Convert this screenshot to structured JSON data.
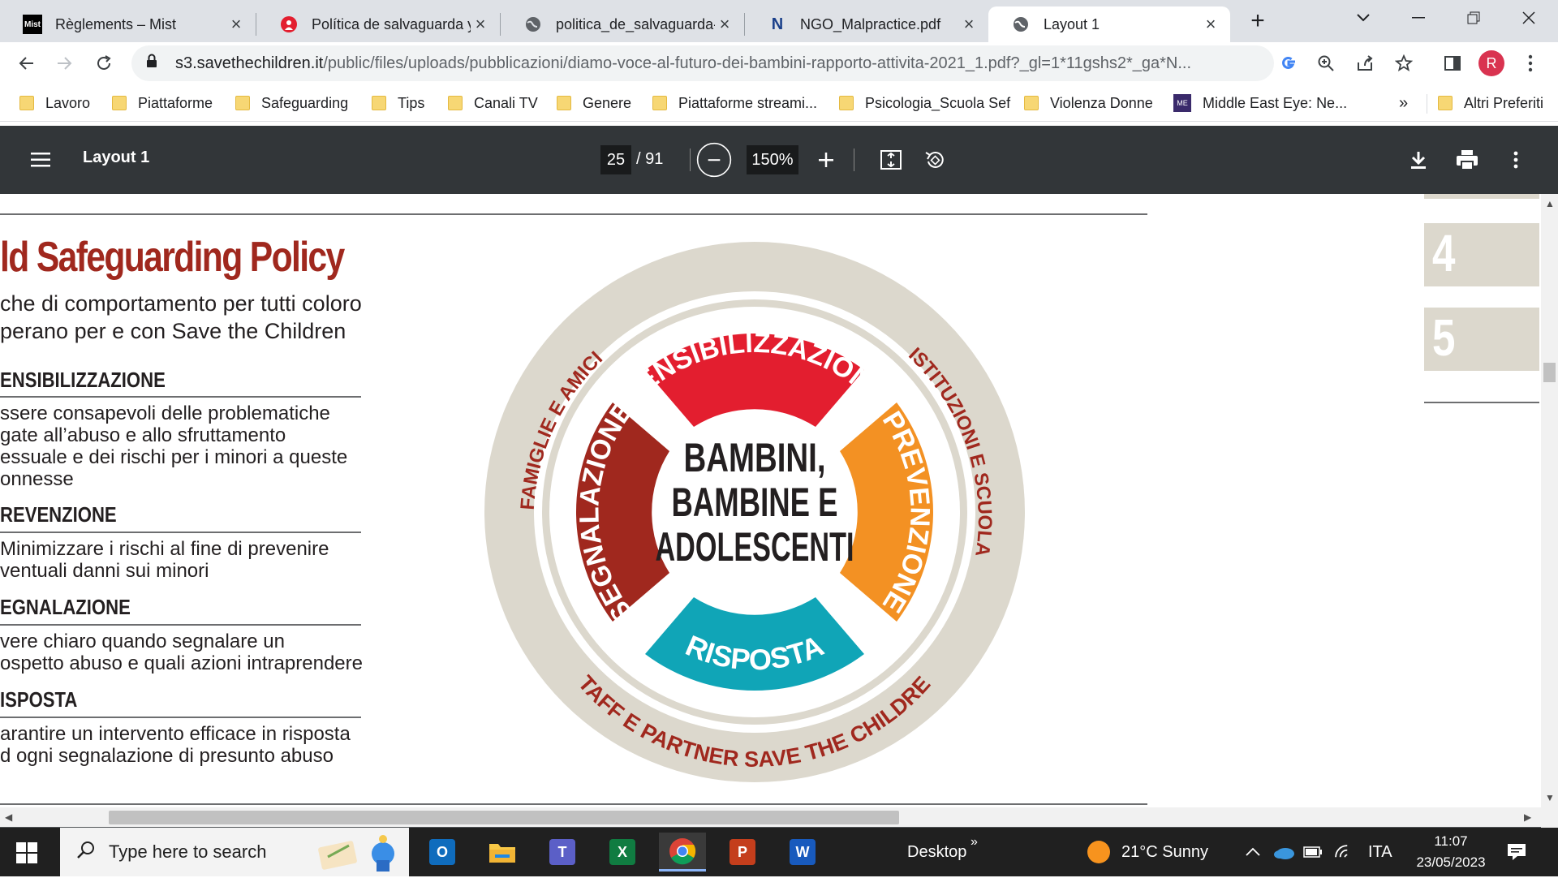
{
  "tabs": [
    {
      "title": "Règlements – Mist",
      "favicon": "Mist"
    },
    {
      "title": "Política de salvaguarda y c",
      "favicon": "savethechildren-icon"
    },
    {
      "title": "politica_de_salvaguarda-c",
      "favicon": "globe-icon"
    },
    {
      "title": "NGO_Malpractice.pdf",
      "favicon": "N"
    },
    {
      "title": "Layout 1",
      "favicon": "globe-icon"
    }
  ],
  "url": {
    "host": "s3.savethechildren.it",
    "path": "/public/files/uploads/pubblicazioni/diamo-voce-al-futuro-dei-bambini-rapporto-attivita-2021_1.pdf?_gl=1*11gshs2*_ga*N..."
  },
  "profile_initial": "R",
  "bookmarks": [
    "Lavoro",
    "Piattaforme",
    "Safeguarding",
    "Tips",
    "Canali TV",
    "Genere",
    "Piattaforme streami...",
    "Psicologia_Scuola Sef",
    "Violenza Donne",
    "Middle East Eye: Ne..."
  ],
  "bookmarks_more": "»",
  "bookmarks_other": "Altri Preferiti",
  "pdf": {
    "title": "Layout 1",
    "page": "25",
    "total": "/ 91",
    "zoom": "150%"
  },
  "document": {
    "headline": "ld Safeguarding Policy",
    "subtitle": [
      "che di comportamento per tutti coloro",
      "perano per e con Save the Children"
    ],
    "sections": [
      {
        "heading": "ENSIBILIZZAZIONE",
        "body": [
          "ssere consapevoli delle problematiche",
          "gate all’abuso e allo sfruttamento",
          "essuale e dei rischi per i minori a queste",
          "onnesse"
        ]
      },
      {
        "heading": "REVENZIONE",
        "body": [
          "Minimizzare i rischi al fine di prevenire",
          "ventuali danni sui minori"
        ]
      },
      {
        "heading": "EGNALAZIONE",
        "body": [
          "vere chiaro quando segnalare un",
          "ospetto abuso e quali azioni intraprendere"
        ]
      },
      {
        "heading": "ISPOSTA",
        "body": [
          "arantire un intervento efficace in risposta",
          "d ogni segnalazione di presunto abuso"
        ]
      }
    ],
    "side_numbers": [
      "4",
      "5"
    ],
    "diagram": {
      "center": [
        "BAMBINI,",
        "BAMBINE E",
        "ADOLESCENTI"
      ],
      "segments": [
        "SENSIBILIZZAZIONE",
        "PREVENZIONE",
        "RISPOSTA",
        "SEGNALAZIONE"
      ],
      "outer": [
        "FAMIGLIE E AMICI",
        "ISTITUZIONI E SCUOLA",
        "STAFF E PARTNER SAVE THE CHILDREN"
      ],
      "colors": {
        "sensibilizzazione": "#e31e2f",
        "prevenzione": "#f39123",
        "risposta": "#10a5b7",
        "segnalazione": "#a0281e",
        "ring": "#dcd8cd",
        "outer_text": "#a0281e"
      }
    }
  },
  "taskbar": {
    "search_placeholder": "Type here to search",
    "apps": [
      "O",
      "folder-icon",
      "T",
      "X",
      "chrome-icon",
      "P",
      "W"
    ],
    "desktop": "Desktop",
    "chevron": "»",
    "weather": "21°C  Sunny",
    "language": "ITA",
    "time": "11:07",
    "date": "23/05/2023"
  }
}
